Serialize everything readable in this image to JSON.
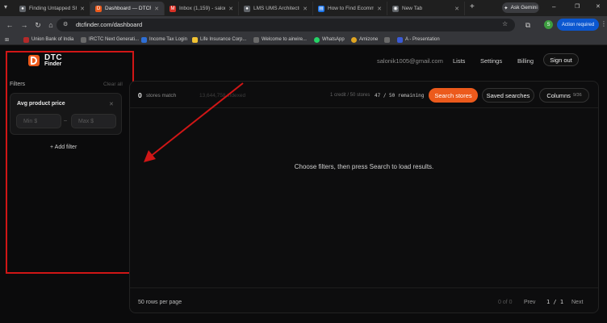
{
  "colors": {
    "accent": "#ec5a1c",
    "highlight_border": "#d01616",
    "annotation_arrow": "#d01616"
  },
  "tabs": [
    {
      "title": "Finding Untapped Sh",
      "icon": "globe-icon"
    },
    {
      "title": "Dashboard — DTCFin",
      "icon": "dtc-logo-icon"
    },
    {
      "title": "Inbox (1,159) - saloni",
      "icon": "gmail-icon"
    },
    {
      "title": "LMS UMS Architectu",
      "icon": "globe-icon"
    },
    {
      "title": "How to Find Ecomm",
      "icon": "doc-icon"
    },
    {
      "title": "New Tab",
      "icon": "chrome-icon"
    }
  ],
  "browser": {
    "url": "dtcfinder.com/dashboard",
    "ask_gemini": "Ask Gemini",
    "action_required": "Action required",
    "profile_initial": "S"
  },
  "bookmarks": [
    "Union Bank of India",
    "IRCTC Next Generati...",
    "Income Tax Login",
    "Life Insurance Corp...",
    "Welcome to airwire...",
    "WhatsApp",
    "Amizone",
    "A - Presentation"
  ],
  "brand": {
    "line1": "DTC",
    "line2": "Finder"
  },
  "topnav": {
    "email": "salonik1005@gmail.com",
    "lists": "Lists",
    "settings": "Settings",
    "billing": "Billing",
    "sign_out": "Sign out"
  },
  "sidebar": {
    "filters_label": "Filters",
    "clear_all": "Clear all",
    "filter_title": "Avg product price",
    "min_placeholder": "Min $",
    "max_placeholder": "Max $",
    "dash": "–",
    "add_filter": "+ Add filter"
  },
  "results": {
    "count": "0",
    "count_suffix": "stores match",
    "indexed": "13,644,758 indexed",
    "credit": "1 credit / 50 stores",
    "remaining": "47 / 50 remaining",
    "search_button": "Search stores",
    "saved_searches": "Saved searches",
    "columns_label": "Columns",
    "columns_count": "9/36",
    "empty_message": "Choose filters, then press Search to load results.",
    "rows_per_page": "50 rows per page",
    "of_count": "0 of 0",
    "prev": "Prev",
    "page": "1 / 1",
    "next": "Next"
  }
}
